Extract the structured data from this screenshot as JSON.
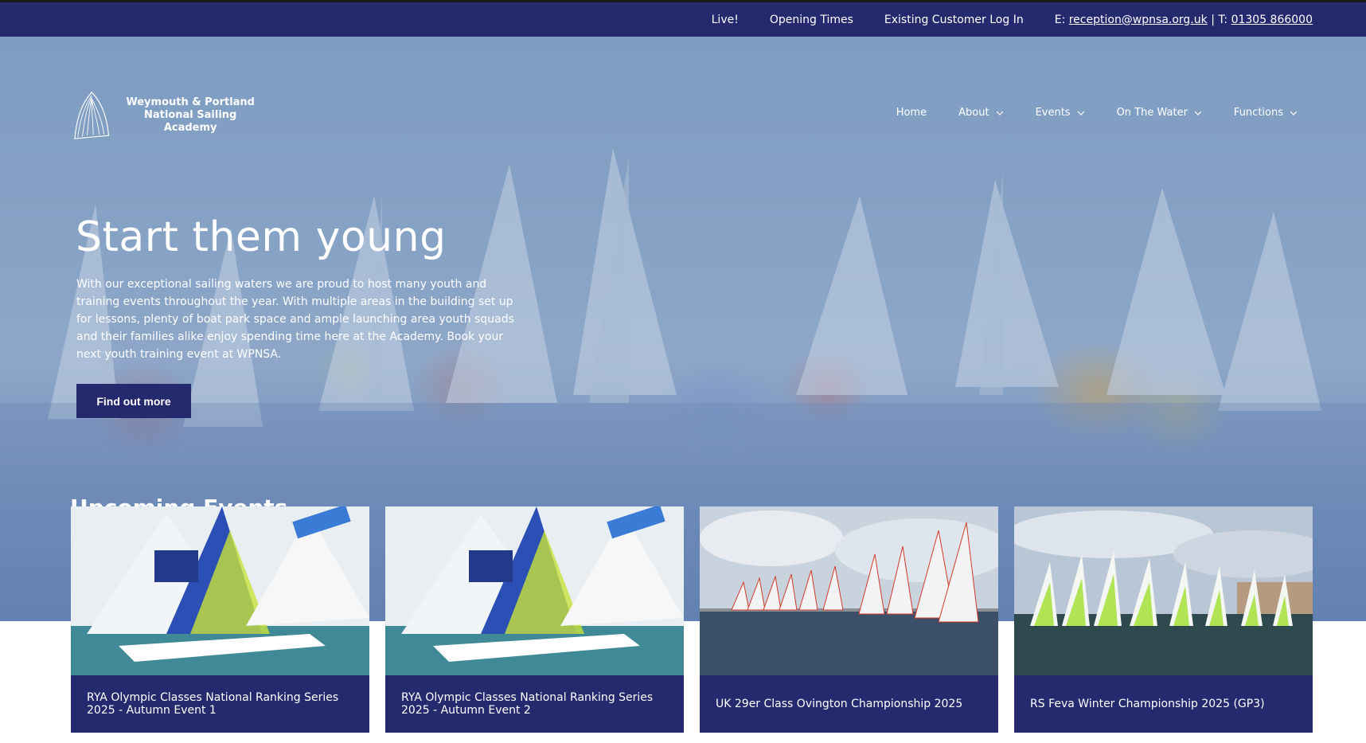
{
  "topbar": {
    "live": "Live!",
    "opening_times": "Opening Times",
    "login": "Existing Customer Log In",
    "email_prefix": "E: ",
    "email": "reception@wpnsa.org.uk",
    "separator": " | T: ",
    "phone": "01305 866000"
  },
  "logo": {
    "line1": "Weymouth & Portland",
    "line2": "National Sailing Academy"
  },
  "nav": {
    "home": "Home",
    "about": "About",
    "events": "Events",
    "on_the_water": "On The Water",
    "functions": "Functions"
  },
  "hero": {
    "headline": "Start them young",
    "blurb": "With our exceptional sailing waters we are proud to host many youth and training events throughout the year. With multiple areas in the building set up for lessons, plenty of boat park space and ample launching area youth squads and their families alike enjoy spending time here at the Academy. Book your next youth training event at WPNSA.",
    "cta": "Find out more"
  },
  "events": {
    "title": "Upcoming Events",
    "items": [
      {
        "title": "RYA Olympic Classes National Ranking Series 2025 - Autumn Event 1"
      },
      {
        "title": "RYA Olympic Classes National Ranking Series 2025 - Autumn Event 2"
      },
      {
        "title": "UK 29er Class Ovington Championship 2025"
      },
      {
        "title": "RS Feva Winter Championship 2025 (GP3)"
      }
    ]
  },
  "colors": {
    "brand_navy": "#252a6e",
    "hero_blue": "#86a2c5"
  }
}
